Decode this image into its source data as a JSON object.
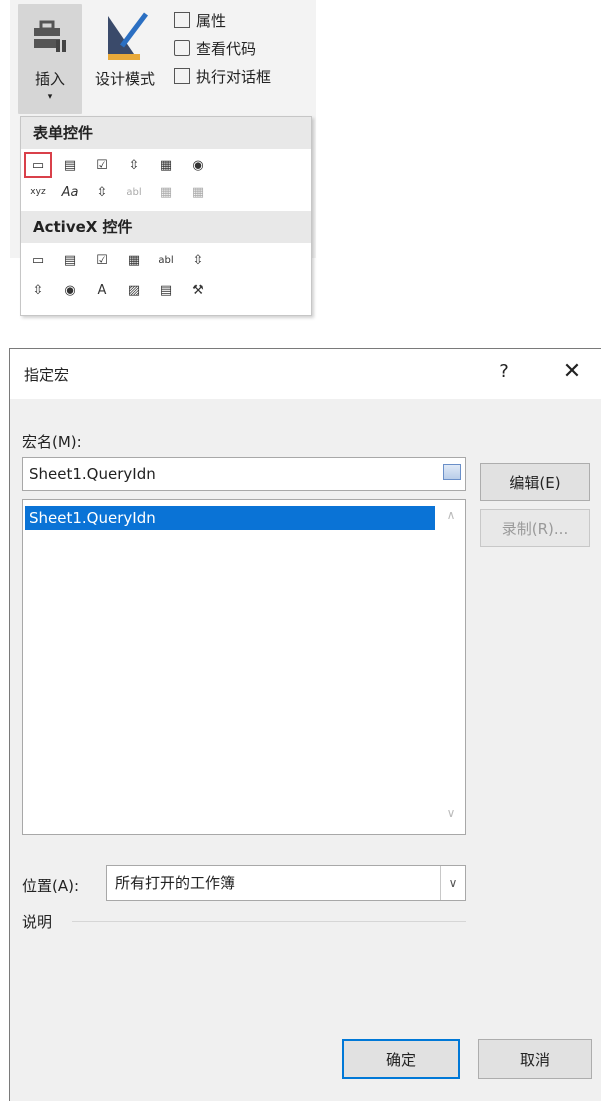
{
  "ribbon": {
    "insert_label": "插入",
    "insert_arrow": "▾",
    "design_label": "设计模式",
    "properties_label": "属性",
    "view_code_label": "查看代码",
    "run_dialog_label": "执行对话框"
  },
  "insert_menu": {
    "form_controls_header": "表单控件",
    "activex_header": "ActiveX 控件",
    "form_row1": [
      "▭",
      "▤",
      "☑",
      "⇳",
      "▦",
      "◉"
    ],
    "form_row2": [
      "xyz",
      "Aa",
      "⇳",
      "abl",
      "▦",
      "▦"
    ],
    "activex_row1": [
      "▭",
      "▤",
      "☑",
      "▦",
      "abl",
      "⇳"
    ],
    "activex_row2": [
      "⇳",
      "◉",
      "A",
      "▨",
      "▤",
      "⚒"
    ]
  },
  "dialog": {
    "title": "指定宏",
    "help": "?",
    "close": "✕",
    "macro_name_label": "宏名(M):",
    "macro_name_value": "Sheet1.QueryIdn",
    "list_items": [
      "Sheet1.QueryIdn"
    ],
    "edit_button": "编辑(E)",
    "record_button": "录制(R)...",
    "location_label": "位置(A):",
    "location_value": "所有打开的工作簿",
    "description_label": "说明",
    "ok_button": "确定",
    "cancel_button": "取消"
  },
  "colors": {
    "selection": "#0a73d6",
    "primary_border": "#0078d7",
    "highlight_red": "#d9404a"
  }
}
